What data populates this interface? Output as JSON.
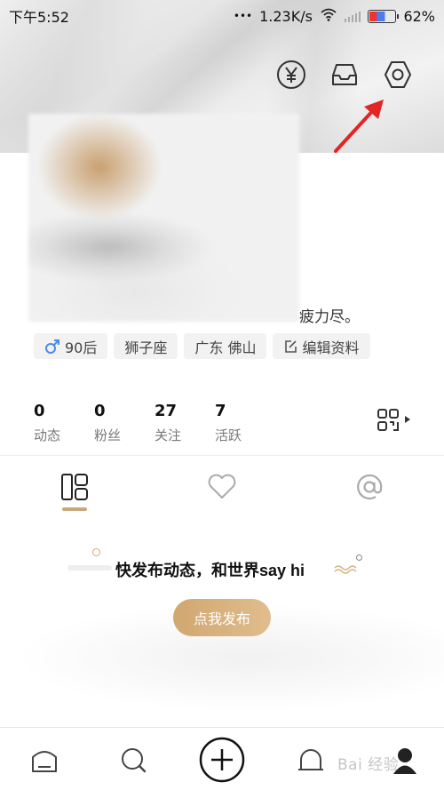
{
  "status_bar": {
    "time": "下午5:52",
    "dots": "•••",
    "network_speed": "1.23K/s",
    "battery_percent": "62%"
  },
  "header": {
    "icons": [
      "yuan-coin-icon",
      "inbox-icon",
      "settings-hexagon-icon"
    ]
  },
  "profile": {
    "bio_visible_tail": "疲力尽。",
    "tags": [
      {
        "icon": "male-icon",
        "label": "90后"
      },
      {
        "icon": "",
        "label": "狮子座"
      },
      {
        "icon": "",
        "label": "广东 佛山"
      },
      {
        "icon": "edit-icon",
        "label": "编辑资料"
      }
    ]
  },
  "stats": [
    {
      "value": "0",
      "label": "动态"
    },
    {
      "value": "0",
      "label": "粉丝"
    },
    {
      "value": "27",
      "label": "关注"
    },
    {
      "value": "7",
      "label": "活跃"
    }
  ],
  "tabs": [
    "grid-layout-icon",
    "heart-icon",
    "at-icon"
  ],
  "empty_state": {
    "title": "快发布动态，和世界say hi",
    "button_label": "点我发布"
  },
  "bottom_nav": [
    "home-icon",
    "search-icon",
    "add-icon",
    "bell-icon",
    "profile-icon"
  ],
  "watermark": "Bai 经验",
  "colors": {
    "accent_gold": "#d1a770",
    "arrow_red": "#e32424"
  }
}
